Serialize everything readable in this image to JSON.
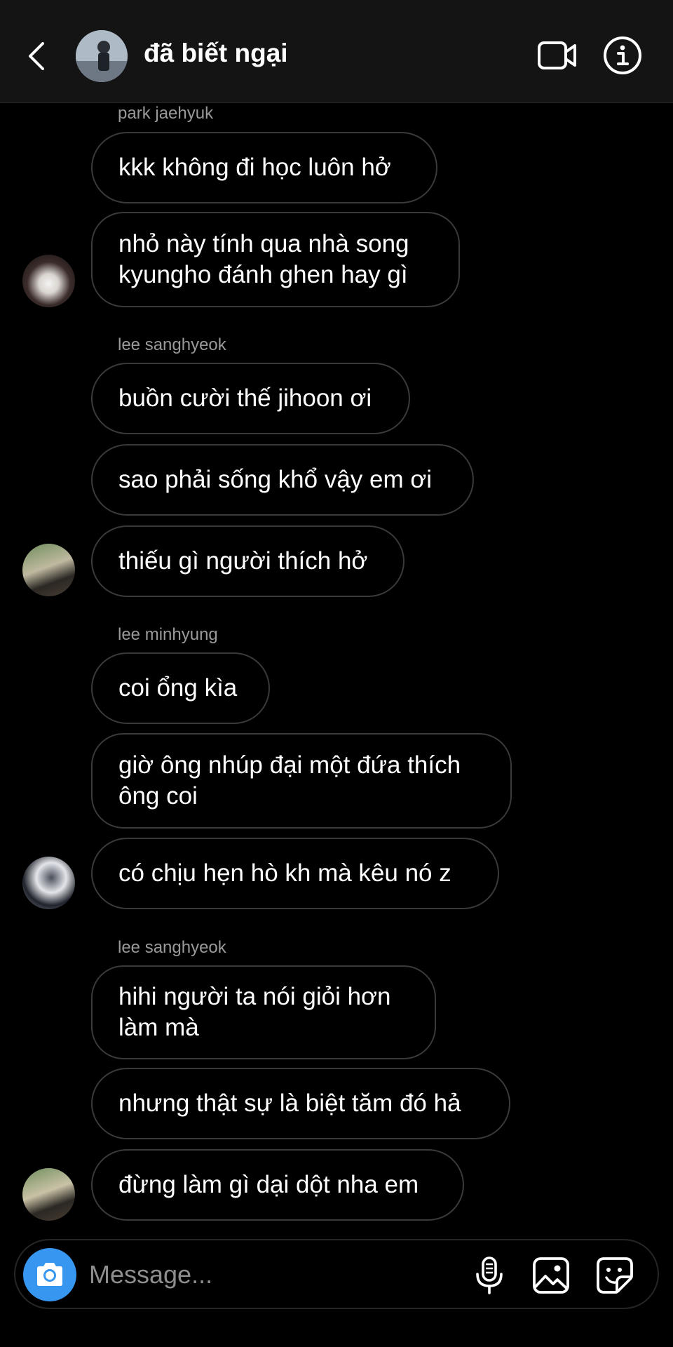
{
  "header": {
    "title": "đã biết ngại",
    "icons": {
      "back": "chevron-left-icon",
      "video": "video-camera-icon",
      "info": "info-icon"
    }
  },
  "thread": {
    "groups": [
      {
        "sender": "park jaehyuk",
        "messages": [
          "kkk không đi học luôn hở",
          "nhỏ này tính qua nhà song\nkyungho đánh ghen hay gì"
        ]
      },
      {
        "sender": "lee sanghyeok",
        "messages": [
          "buồn cười thế jihoon ơi",
          "sao phải sống khổ vậy em ơi",
          "thiếu gì người thích hở"
        ]
      },
      {
        "sender": "lee minhyung",
        "messages": [
          "coi ổng kìa",
          "giờ ông nhúp đại một đứa thích\nông coi",
          "có chịu hẹn hò kh mà kêu nó z"
        ]
      },
      {
        "sender": "lee sanghyeok",
        "messages": [
          "hihi người ta nói giỏi hơn\nlàm mà",
          "nhưng thật sự là biệt tăm đó hả",
          "đừng làm gì dại dột nha em"
        ]
      }
    ]
  },
  "composer": {
    "placeholder": "Message...",
    "accent": "#3797f0",
    "icons": {
      "camera": "camera-icon",
      "mic": "microphone-icon",
      "gallery": "image-icon",
      "sticker": "sticker-icon"
    }
  }
}
